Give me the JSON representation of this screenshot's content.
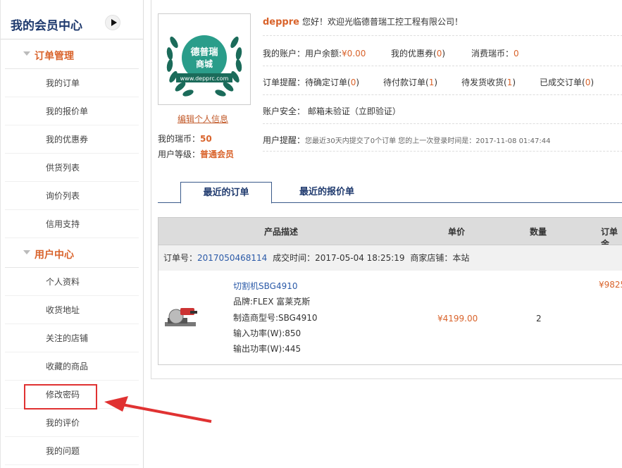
{
  "sidebar": {
    "title": "我的会员中心",
    "groups": [
      {
        "label": "订单管理",
        "items": [
          "我的订单",
          "我的报价单",
          "我的优惠券",
          "供货列表",
          "询价列表",
          "信用支持"
        ]
      },
      {
        "label": "用户中心",
        "items": [
          "个人资料",
          "收货地址",
          "关注的店铺",
          "收藏的商品",
          "修改密码",
          "我的评价",
          "我的问题"
        ]
      }
    ]
  },
  "profile": {
    "logo_text_line1": "德普瑞",
    "logo_text_line2": "商城",
    "logo_url": "www.depprc.com",
    "edit_link": "编辑个人信息",
    "points_label": "我的瑞币：",
    "points_value": "50",
    "level_label": "用户等级：",
    "level_value": "普通会员"
  },
  "welcome": {
    "username": "deppre",
    "message": "您好！欢迎光临德普瑞工控工程有限公司！"
  },
  "account": {
    "balance_label": "我的账户：用户余额:",
    "balance_value": "¥0.00",
    "coupon_label": "我的优惠券(",
    "coupon_value": "0",
    "coupon_close": ")",
    "consume_label": "消费瑞币：",
    "consume_value": "0"
  },
  "reminders": {
    "label": "订单提醒：",
    "items": [
      {
        "label": "待确定订单(",
        "value": "0"
      },
      {
        "label": "待付款订单(",
        "value": "1"
      },
      {
        "label": "待发货收货(",
        "value": "1"
      },
      {
        "label": "已成交订单(",
        "value": "0"
      }
    ],
    "close": ")"
  },
  "security": {
    "text": "账户安全： 邮箱未验证（立即验证）"
  },
  "user_notice": {
    "label": "用户提醒：",
    "text": "您最近30天内提交了0个订单 您的上一次登录时间是：2017-11-08 01:47:44"
  },
  "tabs": [
    "最近的订单",
    "最近的报价单"
  ],
  "table": {
    "headers": [
      "产品描述",
      "单价",
      "数量",
      "订单金"
    ],
    "order_label": "订单号：",
    "order_number": "2017050468114",
    "deal_time": "成交时间：2017-05-04 18:25:19",
    "shop": "商家店铺：本站",
    "product": {
      "name": "切割机SBG4910",
      "brand": "品牌:FLEX 富莱克斯",
      "model": "制造商型号:SBG4910",
      "input_power": "输入功率(W):850",
      "output_power": "输出功率(W):445",
      "price": "¥4199.00",
      "qty": "2",
      "total": "¥9825"
    }
  },
  "colors": {
    "accent": "#d9632b",
    "brand": "#1f3a6e",
    "link": "#2b5aa8",
    "highlight": "#e03232"
  }
}
